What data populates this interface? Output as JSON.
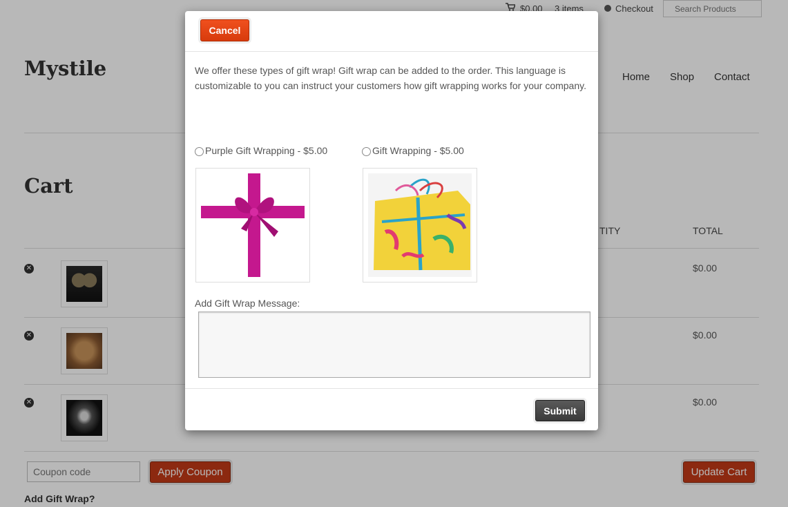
{
  "topbar": {
    "cart_amount": "$0.00",
    "cart_items": "3 items",
    "checkout_label": "Checkout",
    "search_placeholder": "Search Products"
  },
  "site": {
    "logo": "Mystile",
    "nav": [
      "Home",
      "Shop",
      "Contact"
    ]
  },
  "cart": {
    "title": "Cart",
    "columns": {
      "quantity": "TITY",
      "total": "TOTAL"
    },
    "rows": [
      {
        "total": "$0.00"
      },
      {
        "total": "$0.00"
      },
      {
        "total": "$0.00"
      }
    ],
    "coupon_placeholder": "Coupon code",
    "apply_coupon_label": "Apply Coupon",
    "update_cart_label": "Update Cart",
    "add_gift_wrap_label": "Add Gift Wrap?"
  },
  "modal": {
    "cancel_label": "Cancel",
    "intro": "We offer these types of gift wrap! Gift wrap can be added to the order. This language is customizable to you can instruct your customers how gift wrapping works for your company.",
    "options": [
      {
        "label": "Purple Gift Wrapping - $5.00"
      },
      {
        "label": "Gift Wrapping - $5.00"
      }
    ],
    "message_label": "Add Gift Wrap Message:",
    "message_value": "",
    "submit_label": "Submit"
  },
  "colors": {
    "accent_red": "#c23a17",
    "cancel_orange": "#e8460f",
    "ribbon_magenta": "#c4188e",
    "submit_dark": "#444444"
  }
}
